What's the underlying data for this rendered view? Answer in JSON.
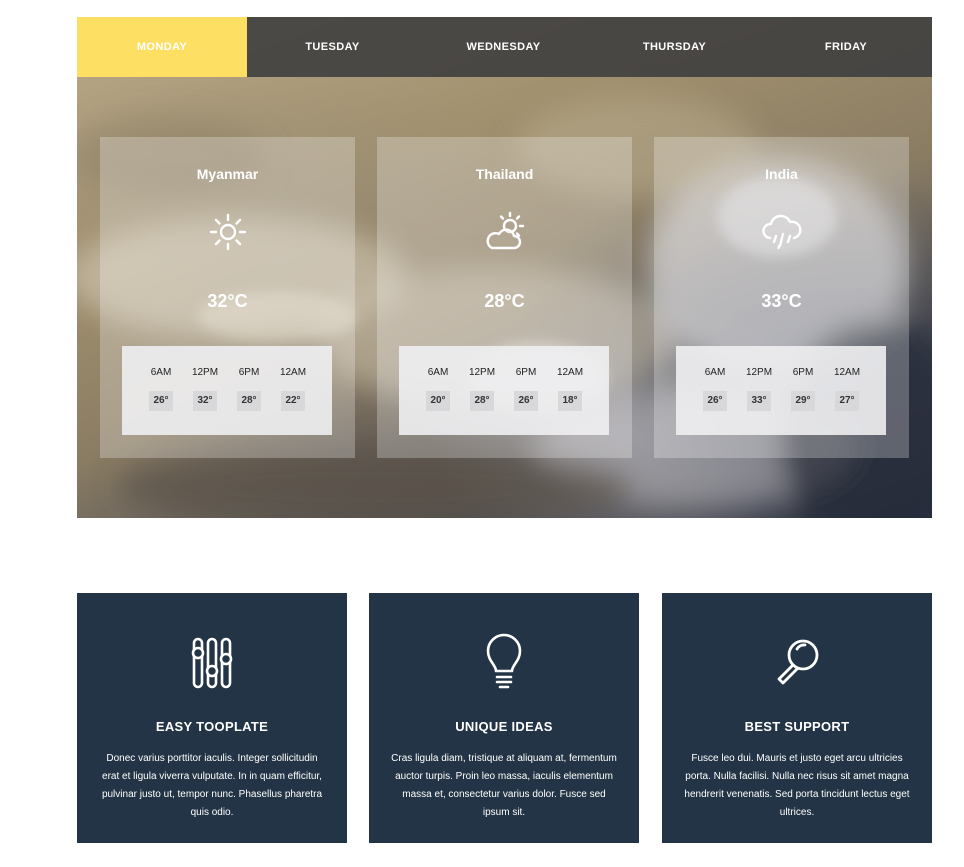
{
  "tabs": [
    {
      "label": "MONDAY",
      "active": true
    },
    {
      "label": "TUESDAY",
      "active": false
    },
    {
      "label": "WEDNESDAY",
      "active": false
    },
    {
      "label": "THURSDAY",
      "active": false
    },
    {
      "label": "FRIDAY",
      "active": false
    }
  ],
  "weather_cards": [
    {
      "city": "Myanmar",
      "icon": "sun-icon",
      "temp": "32°C",
      "hourly": [
        {
          "time": "6AM",
          "deg": "26°"
        },
        {
          "time": "12PM",
          "deg": "32°"
        },
        {
          "time": "6PM",
          "deg": "28°"
        },
        {
          "time": "12AM",
          "deg": "22°"
        }
      ]
    },
    {
      "city": "Thailand",
      "icon": "partly-cloudy-icon",
      "temp": "28°C",
      "hourly": [
        {
          "time": "6AM",
          "deg": "20°"
        },
        {
          "time": "12PM",
          "deg": "28°"
        },
        {
          "time": "6PM",
          "deg": "26°"
        },
        {
          "time": "12AM",
          "deg": "18°"
        }
      ]
    },
    {
      "city": "India",
      "icon": "rain-cloud-icon",
      "temp": "33°C",
      "hourly": [
        {
          "time": "6AM",
          "deg": "26°"
        },
        {
          "time": "12PM",
          "deg": "33°"
        },
        {
          "time": "6PM",
          "deg": "29°"
        },
        {
          "time": "12AM",
          "deg": "27°"
        }
      ]
    }
  ],
  "features": [
    {
      "icon": "sliders-icon",
      "title": "EASY TOOPLATE",
      "text": "Donec varius porttitor iaculis. Integer sollicitudin erat et ligula viverra vulputate. In in quam efficitur, pulvinar justo ut, tempor nunc. Phasellus pharetra quis odio."
    },
    {
      "icon": "lightbulb-icon",
      "title": "UNIQUE IDEAS",
      "text": "Cras ligula diam, tristique at aliquam at, fermentum auctor turpis. Proin leo massa, iaculis elementum massa et, consectetur varius dolor. Fusce sed ipsum sit."
    },
    {
      "icon": "magnifier-icon",
      "title": "BEST SUPPORT",
      "text": "Fusce leo dui. Mauris et justo eget arcu ultricies porta. Nulla facilisi. Nulla nec risus sit amet magna hendrerit venenatis. Sed porta tincidunt lectus eget ultrices."
    }
  ],
  "colors": {
    "active_tab": "#fddf63",
    "feature_bg": "#223445"
  }
}
